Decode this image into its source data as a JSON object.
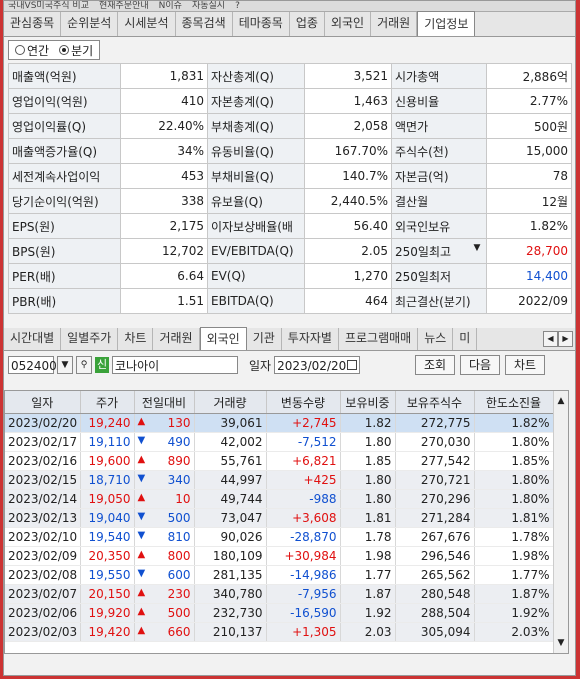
{
  "top_strip": [
    "국내VS미국주식 비교",
    "현재주문안내",
    "N이슈",
    "자동실시",
    "?"
  ],
  "tabs": [
    "관심종목",
    "순위분석",
    "시세분석",
    "종목검색",
    "테마종목",
    "업종",
    "외국인",
    "거래원",
    "기업정보"
  ],
  "active_tab": "기업정보",
  "period": {
    "annual": "연간",
    "quarter": "분기",
    "selected": "분기"
  },
  "info_rows": [
    [
      {
        "l": "매출액(억원)",
        "v": "1,831"
      },
      {
        "l": "자산총계(Q)",
        "v": "3,521"
      },
      {
        "l": "시가총액",
        "v": "2,886억"
      }
    ],
    [
      {
        "l": "영업이익(억원)",
        "v": "410"
      },
      {
        "l": "자본총계(Q)",
        "v": "1,463"
      },
      {
        "l": "신용비율",
        "v": "2.77%"
      }
    ],
    [
      {
        "l": "영업이익률(Q)",
        "v": "22.40%"
      },
      {
        "l": "부채총계(Q)",
        "v": "2,058"
      },
      {
        "l": "액면가",
        "v": "500원"
      }
    ],
    [
      {
        "l": "매출액증가율(Q)",
        "v": "34%"
      },
      {
        "l": "유동비율(Q)",
        "v": "167.70%"
      },
      {
        "l": "주식수(천)",
        "v": "15,000"
      }
    ],
    [
      {
        "l": "세전계속사업이익",
        "v": "453"
      },
      {
        "l": "부채비율(Q)",
        "v": "140.7%"
      },
      {
        "l": "자본금(억)",
        "v": "78"
      }
    ],
    [
      {
        "l": "당기순이익(억원)",
        "v": "338"
      },
      {
        "l": "유보율(Q)",
        "v": "2,440.5%"
      },
      {
        "l": "결산월",
        "v": "12월"
      }
    ],
    [
      {
        "l": "EPS(원)",
        "v": "2,175"
      },
      {
        "l": "이자보상배율(배",
        "v": "56.40"
      },
      {
        "l": "외국인보유",
        "v": "1.82%"
      }
    ],
    [
      {
        "l": "BPS(원)",
        "v": "12,702"
      },
      {
        "l": "EV/EBITDA(Q)",
        "v": "2.05"
      },
      {
        "l": "250일최고",
        "v": "28,700"
      }
    ],
    [
      {
        "l": "PER(배)",
        "v": "6.64"
      },
      {
        "l": "EV(Q)",
        "v": "1,270"
      },
      {
        "l": "250일최저",
        "v": "14,400"
      }
    ],
    [
      {
        "l": "PBR(배)",
        "v": "1.51"
      },
      {
        "l": "EBITDA(Q)",
        "v": "464"
      },
      {
        "l": "최근결산(분기)",
        "v": "2022/09"
      }
    ]
  ],
  "lower_tabs": [
    "시간대별",
    "일별주가",
    "차트",
    "거래원",
    "외국인",
    "기관",
    "투자자별",
    "프로그램매매",
    "뉴스",
    "미"
  ],
  "active_lower_tab": "외국인",
  "toolbar": {
    "code": "052400",
    "stock_badge": "신",
    "stock_name": "코나아이",
    "date_label": "일자",
    "date": "2023/02/20",
    "query": "조회",
    "next": "다음",
    "chart": "차트"
  },
  "columns": [
    "일자",
    "주가",
    "전일대비",
    "거래량",
    "변동수량",
    "보유비중",
    "보유주식수",
    "한도소진율"
  ],
  "rows": [
    {
      "date": "2023/02/20",
      "price": "19,240",
      "dir": "up",
      "chg": "130",
      "vol": "39,061",
      "delta": "+2,745",
      "ratio": "1.82",
      "shares": "272,775",
      "limit": "1.82%"
    },
    {
      "date": "2023/02/17",
      "price": "19,110",
      "dir": "dn",
      "chg": "490",
      "vol": "42,002",
      "delta": "-7,512",
      "ratio": "1.80",
      "shares": "270,030",
      "limit": "1.80%"
    },
    {
      "date": "2023/02/16",
      "price": "19,600",
      "dir": "up",
      "chg": "890",
      "vol": "55,761",
      "delta": "+6,821",
      "ratio": "1.85",
      "shares": "277,542",
      "limit": "1.85%"
    },
    {
      "date": "2023/02/15",
      "price": "18,710",
      "dir": "dn",
      "chg": "340",
      "vol": "44,997",
      "delta": "+425",
      "ratio": "1.80",
      "shares": "270,721",
      "limit": "1.80%"
    },
    {
      "date": "2023/02/14",
      "price": "19,050",
      "dir": "up",
      "chg": "10",
      "vol": "49,744",
      "delta": "-988",
      "ratio": "1.80",
      "shares": "270,296",
      "limit": "1.80%"
    },
    {
      "date": "2023/02/13",
      "price": "19,040",
      "dir": "dn",
      "chg": "500",
      "vol": "73,047",
      "delta": "+3,608",
      "ratio": "1.81",
      "shares": "271,284",
      "limit": "1.81%"
    },
    {
      "date": "2023/02/10",
      "price": "19,540",
      "dir": "dn",
      "chg": "810",
      "vol": "90,026",
      "delta": "-28,870",
      "ratio": "1.78",
      "shares": "267,676",
      "limit": "1.78%"
    },
    {
      "date": "2023/02/09",
      "price": "20,350",
      "dir": "up",
      "chg": "800",
      "vol": "180,109",
      "delta": "+30,984",
      "ratio": "1.98",
      "shares": "296,546",
      "limit": "1.98%"
    },
    {
      "date": "2023/02/08",
      "price": "19,550",
      "dir": "dn",
      "chg": "600",
      "vol": "281,135",
      "delta": "-14,986",
      "ratio": "1.77",
      "shares": "265,562",
      "limit": "1.77%"
    },
    {
      "date": "2023/02/07",
      "price": "20,150",
      "dir": "up",
      "chg": "230",
      "vol": "340,780",
      "delta": "-7,956",
      "ratio": "1.87",
      "shares": "280,548",
      "limit": "1.87%"
    },
    {
      "date": "2023/02/06",
      "price": "19,920",
      "dir": "up",
      "chg": "500",
      "vol": "232,730",
      "delta": "-16,590",
      "ratio": "1.92",
      "shares": "288,504",
      "limit": "1.92%"
    },
    {
      "date": "2023/02/03",
      "price": "19,420",
      "dir": "up",
      "chg": "660",
      "vol": "210,137",
      "delta": "+1,305",
      "ratio": "2.03",
      "shares": "305,094",
      "limit": "2.03%"
    }
  ],
  "colors": {
    "up": "#e01010",
    "down": "#1050d0",
    "highlight": "#cfe0f3"
  }
}
